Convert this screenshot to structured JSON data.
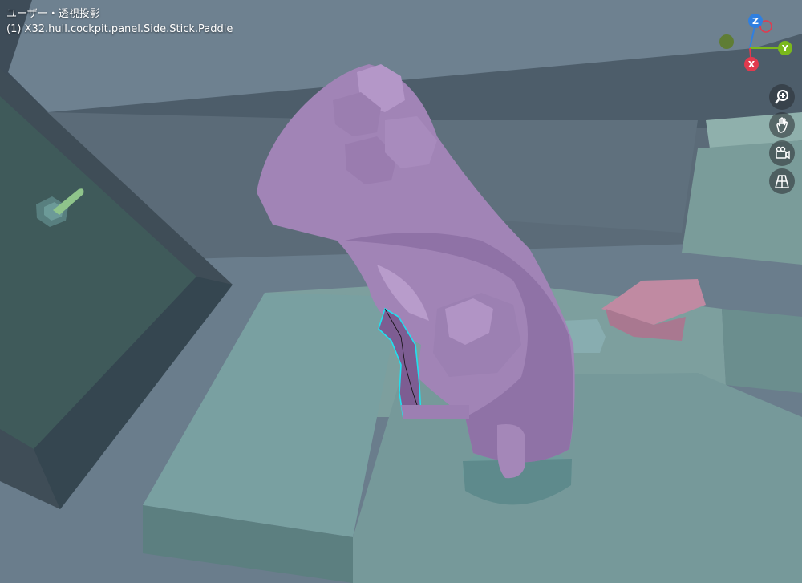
{
  "viewport": {
    "view_name": "ユーザー・透視投影",
    "object_name": "(1) X32.hull.cockpit.panel.Side.Stick.Paddle"
  },
  "gizmo": {
    "z_label": "Z",
    "y_label": "Y",
    "x_label": "X",
    "colors": {
      "z": "#2f7fe0",
      "y": "#7ab81c",
      "x": "#e23a4e",
      "neg_y": "#5f7d35"
    }
  },
  "nav": {
    "zoom_icon": "zoom-icon",
    "pan_icon": "hand-pan-icon",
    "camera_icon": "camera-view-icon",
    "ortho_icon": "grid-ortho-icon"
  },
  "colors": {
    "stick_purple": "#a184b6",
    "panel_teal": "#7fa3a2",
    "wall_blue": "#5b6b78",
    "selection_cyan": "#20e0f0"
  }
}
